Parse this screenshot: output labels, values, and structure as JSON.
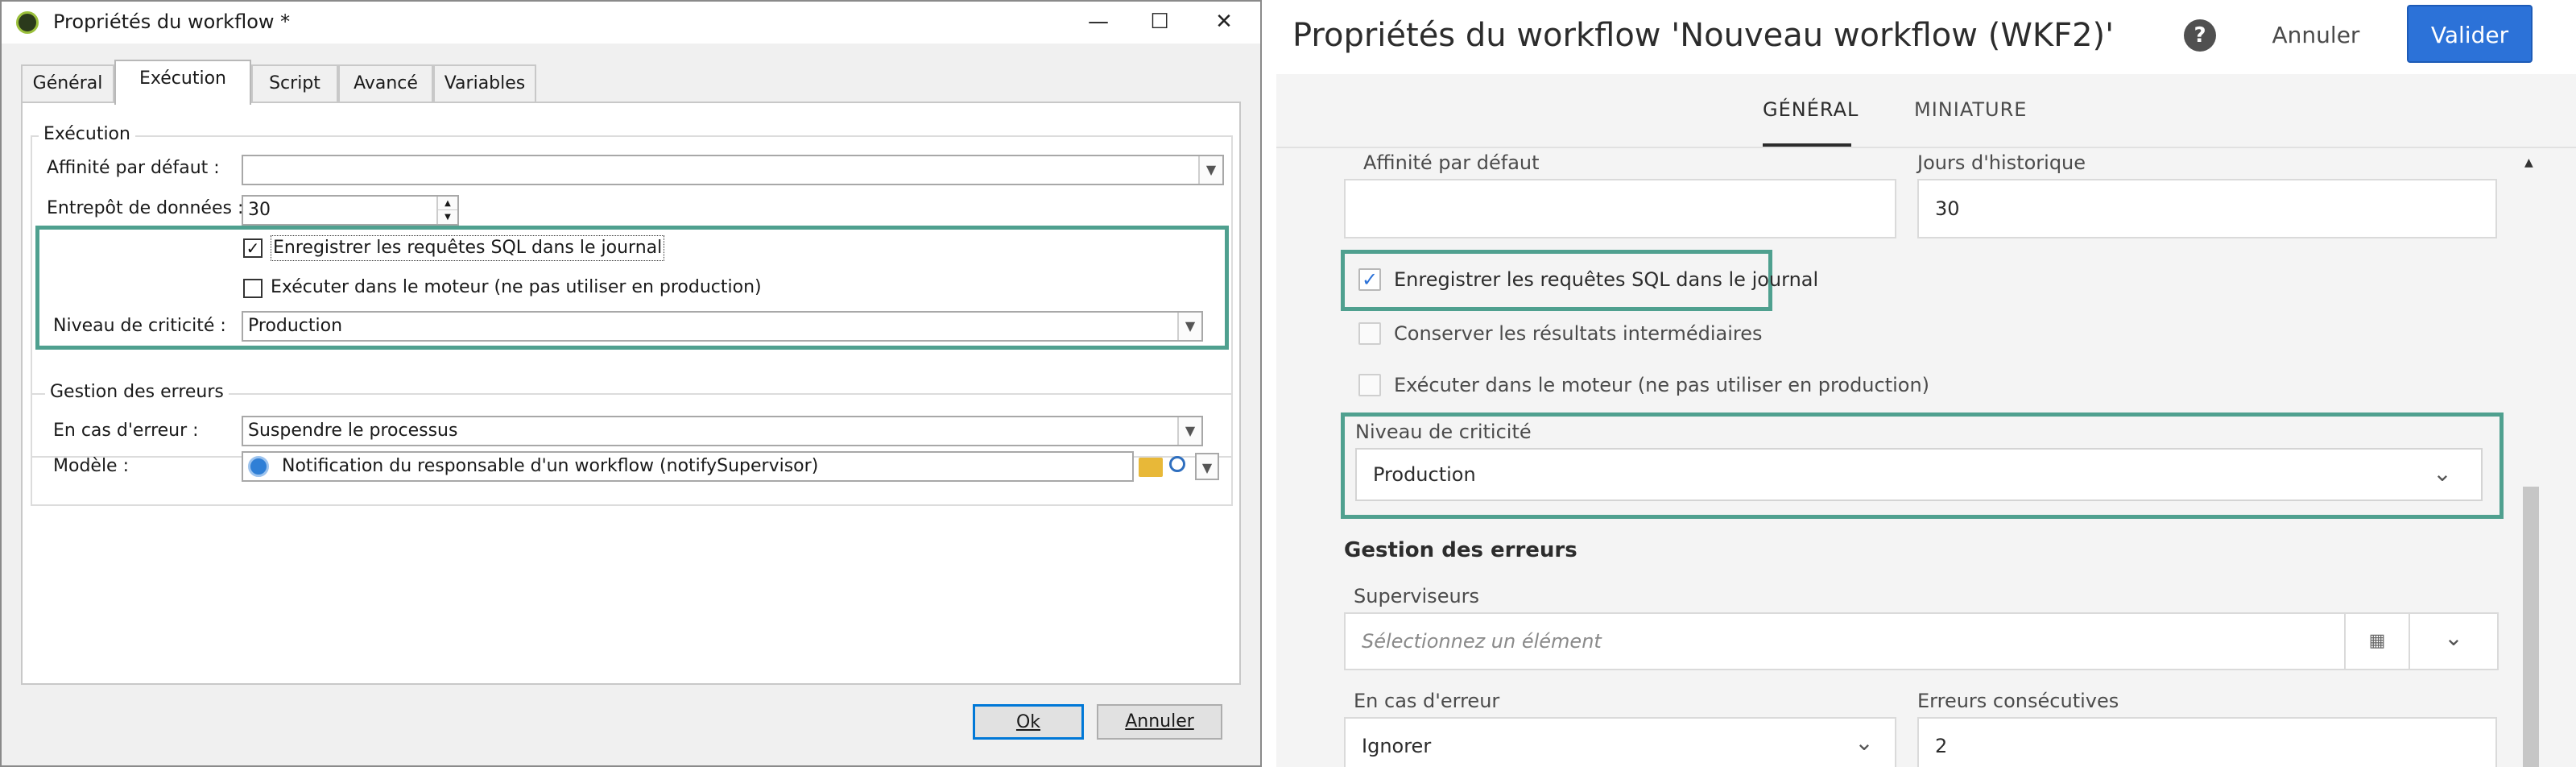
{
  "left": {
    "title": "Propriétés du workflow *",
    "window_controls": [
      "—",
      "☐",
      "✕"
    ],
    "tabs": [
      "Général",
      "Exécution",
      "Script",
      "Avancé",
      "Variables"
    ],
    "execution_group": {
      "title": "Exécution",
      "affinity_label": "Affinité par défaut :",
      "affinity_value": "",
      "datastore_label": "Entrepôt de données :",
      "datastore_value": "30",
      "log_sql_label": "Enregistrer les requêtes SQL dans le journal",
      "log_sql_checked": true,
      "run_engine_label": "Exécuter dans le moteur (ne pas utiliser en production)",
      "run_engine_checked": false,
      "criticality_label": "Niveau de criticité :",
      "criticality_value": "Production"
    },
    "error_group": {
      "title": "Gestion des erreurs",
      "on_error_label": "En cas d'erreur :",
      "on_error_value": "Suspendre le processus",
      "template_label": "Modèle :",
      "template_value": "Notification du responsable d'un workflow (notifySupervisor)"
    },
    "buttons": {
      "ok": "Ok",
      "cancel": "Annuler"
    }
  },
  "right": {
    "title": "Propriétés du workflow 'Nouveau workflow (WKF2)'",
    "help_glyph": "?",
    "cancel_label": "Annuler",
    "validate_label": "Valider",
    "tabs": [
      "GÉNÉRAL",
      "MINIATURE"
    ],
    "affinity_label": "Affinité par défaut",
    "affinity_value": "",
    "history_label": "Jours d'historique",
    "history_value": "30",
    "log_sql_label": "Enregistrer les requêtes SQL dans le journal",
    "log_sql_checked": true,
    "keep_results_label": "Conserver les résultats intermédiaires",
    "keep_results_checked": false,
    "run_engine_label": "Exécuter dans le moteur (ne pas utiliser en production)",
    "run_engine_checked": false,
    "criticality_label": "Niveau de criticité",
    "criticality_value": "Production",
    "error_section_title": "Gestion des erreurs",
    "supervisors_label": "Superviseurs",
    "supervisors_placeholder": "Sélectionnez un élément",
    "on_error_label": "En cas d'erreur",
    "on_error_value": "Ignorer",
    "consecutive_errors_label": "Erreurs consécutives",
    "consecutive_errors_value": "2"
  },
  "colors": {
    "highlight": "#4fa08f",
    "primary_button": "#2c72d8",
    "checkbox_mark": "#2c72d8"
  }
}
